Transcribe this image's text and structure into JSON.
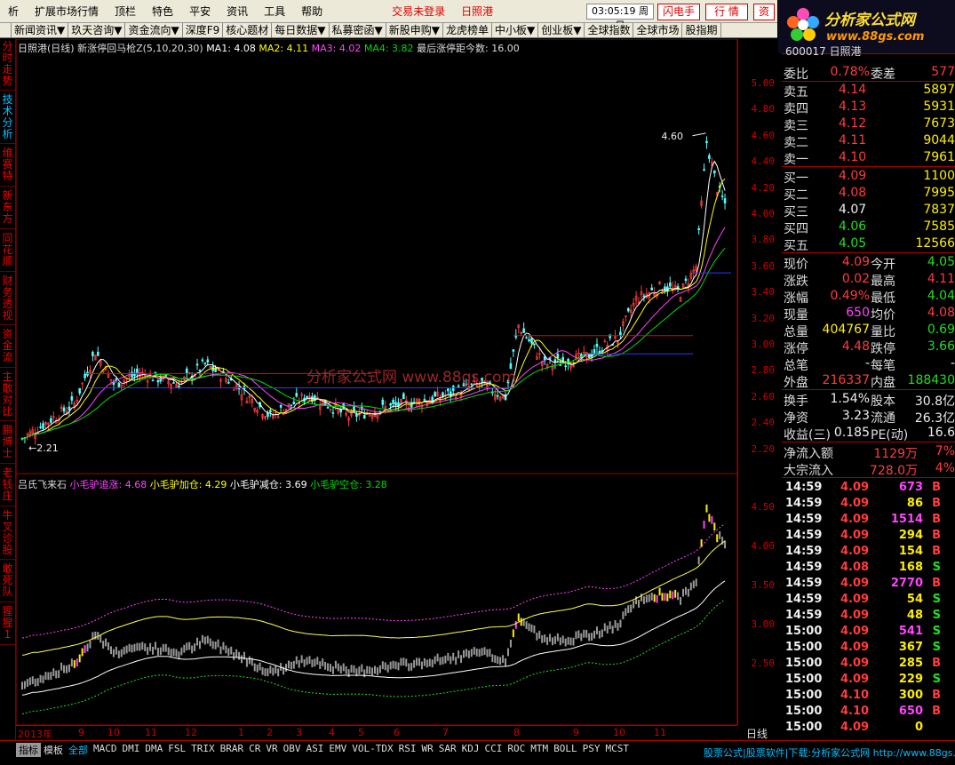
{
  "menu": {
    "items": [
      "析",
      "扩展市场行情",
      "顶栏",
      "特色",
      "平安",
      "资讯",
      "工具",
      "帮助"
    ],
    "trade_status": "交易未登录",
    "stock_name": "日照港",
    "clock": "03:05:19 周日",
    "btn_flash": "闪电手",
    "btn_quote": "行 情",
    "btn_info": "资"
  },
  "toolbar": [
    "新闻资讯▼",
    "玖天咨询▼",
    "资金流向▼",
    "深度F9",
    "核心题材",
    "每日数据▼",
    "私募密函▼",
    "新股申购▼",
    "龙虎榜单",
    "中小板▼",
    "创业板▼",
    "全球指数",
    "全球市场",
    "股指期"
  ],
  "logo": {
    "title": "分析家公式网",
    "url": "www.88gs.com"
  },
  "left_tabs": [
    "分时走势",
    "技术分析",
    "维赛特",
    "新东方",
    "同花顺",
    "财务透视",
    "资金流",
    "主散对比",
    "鹏博士",
    "老钱庄",
    "牛叉诊股",
    "敢死队",
    "猩猩1"
  ],
  "main_head": {
    "title": "日照港(日线) 新涨停回马枪Z(5,10,20,30)",
    "ma1": "MA1: 4.08",
    "ma2": "MA2: 4.11",
    "ma3": "MA3: 4.02",
    "ma4": "MA4: 3.82",
    "extra": "最后涨停距今数: 16.00"
  },
  "sub_head": {
    "name": "吕氏飞来石",
    "l1": "小毛驴追涨: 4.68",
    "l2": "小毛驴加仓: 4.29",
    "l3": "小毛驴减仓: 3.69",
    "l4": "小毛驴空仓: 3.28"
  },
  "watermark": "分析家公式网 www.88gs.com",
  "annotations": {
    "high": "4.60",
    "low": "2.21"
  },
  "price_axis": [
    "5.00",
    "4.80",
    "4.60",
    "4.40",
    "4.20",
    "4.00",
    "3.80",
    "3.60",
    "3.40",
    "3.20",
    "3.00",
    "2.80",
    "2.60",
    "2.40",
    "2.20"
  ],
  "sub_axis": [
    "4.50",
    "4.00",
    "3.50",
    "3.00",
    "2.50"
  ],
  "date_axis": [
    "2013年",
    "9",
    "10",
    "11",
    "12",
    "1",
    "2",
    "3",
    "4",
    "5",
    "6",
    "7",
    "8",
    "9",
    "10",
    "11"
  ],
  "period_label": "日线",
  "bottom_tabs": [
    "指标",
    "模板",
    "全部",
    "MACD",
    "DMI",
    "DMA",
    "FSL",
    "TRIX",
    "BRAR",
    "CR",
    "VR",
    "OBV",
    "ASI",
    "EMV",
    "VOL-TDX",
    "RSI",
    "WR",
    "SAR",
    "KDJ",
    "CCI",
    "ROC",
    "MTM",
    "BOLL",
    "PSY",
    "MCST"
  ],
  "footer": "股票公式|股票软件|下载:分析家公式网 http://www.88gs.com",
  "quote": {
    "code_line": "600017 日照港",
    "weibi": {
      "label": "委比",
      "value": "0.78%",
      "label2": "委差",
      "value2": "577"
    },
    "asks": [
      {
        "label": "卖五",
        "price": "4.14",
        "vol": "5897"
      },
      {
        "label": "卖四",
        "price": "4.13",
        "vol": "5931"
      },
      {
        "label": "卖三",
        "price": "4.12",
        "vol": "7673"
      },
      {
        "label": "卖二",
        "price": "4.11",
        "vol": "9044"
      },
      {
        "label": "卖一",
        "price": "4.10",
        "vol": "7961"
      }
    ],
    "bids": [
      {
        "label": "买一",
        "price": "4.09",
        "vol": "1100"
      },
      {
        "label": "买二",
        "price": "4.08",
        "vol": "7995"
      },
      {
        "label": "买三",
        "price": "4.07",
        "vol": "7837"
      },
      {
        "label": "买四",
        "price": "4.06",
        "vol": "7585"
      },
      {
        "label": "买五",
        "price": "4.05",
        "vol": "12566"
      }
    ],
    "stats": [
      {
        "l1": "现价",
        "v1": "4.09",
        "c1": "red",
        "l2": "今开",
        "v2": "4.05",
        "c2": "grn"
      },
      {
        "l1": "涨跌",
        "v1": "0.02",
        "c1": "red",
        "l2": "最高",
        "v2": "4.11",
        "c2": "red"
      },
      {
        "l1": "涨幅",
        "v1": "0.49%",
        "c1": "red",
        "l2": "最低",
        "v2": "4.04",
        "c2": "grn"
      },
      {
        "l1": "现量",
        "v1": "650",
        "c1": "mag",
        "l2": "均价",
        "v2": "4.08",
        "c2": "red"
      },
      {
        "l1": "总量",
        "v1": "404767",
        "c1": "yel",
        "l2": "量比",
        "v2": "0.69",
        "c2": "grn"
      },
      {
        "l1": "涨停",
        "v1": "4.48",
        "c1": "red",
        "l2": "跌停",
        "v2": "3.66",
        "c2": "grn"
      },
      {
        "l1": "总笔",
        "v1": "-",
        "c1": "wht",
        "l2": "每笔",
        "v2": "-",
        "c2": "wht"
      },
      {
        "l1": "外盘",
        "v1": "216337",
        "c1": "red",
        "l2": "内盘",
        "v2": "188430",
        "c2": "grn"
      }
    ],
    "fund": [
      {
        "l1": "换手",
        "v1": "1.54%",
        "c1": "wht",
        "l2": "股本",
        "v2": "30.8亿",
        "c2": "wht"
      },
      {
        "l1": "净资",
        "v1": "3.23",
        "c1": "wht",
        "l2": "流通",
        "v2": "26.3亿",
        "c2": "wht"
      },
      {
        "l1": "收益(三)",
        "v1": "0.185",
        "c1": "wht",
        "l2": "PE(动)",
        "v2": "16.6",
        "c2": "wht"
      }
    ],
    "flows": [
      {
        "label": "净流入额",
        "v1": "1129万",
        "v2": "7%"
      },
      {
        "label": "大宗流入",
        "v1": "728.0万",
        "v2": "4%"
      }
    ],
    "ticks": [
      {
        "t": "14:59",
        "p": "4.09",
        "v": "673",
        "s": "B"
      },
      {
        "t": "14:59",
        "p": "4.09",
        "v": "86",
        "s": "B"
      },
      {
        "t": "14:59",
        "p": "4.09",
        "v": "1514",
        "s": "B"
      },
      {
        "t": "14:59",
        "p": "4.09",
        "v": "294",
        "s": "B"
      },
      {
        "t": "14:59",
        "p": "4.09",
        "v": "154",
        "s": "B"
      },
      {
        "t": "14:59",
        "p": "4.08",
        "v": "168",
        "s": "S"
      },
      {
        "t": "14:59",
        "p": "4.09",
        "v": "2770",
        "s": "B"
      },
      {
        "t": "14:59",
        "p": "4.09",
        "v": "54",
        "s": "S"
      },
      {
        "t": "14:59",
        "p": "4.09",
        "v": "48",
        "s": "S"
      },
      {
        "t": "15:00",
        "p": "4.09",
        "v": "541",
        "s": "S"
      },
      {
        "t": "15:00",
        "p": "4.09",
        "v": "367",
        "s": "S"
      },
      {
        "t": "15:00",
        "p": "4.09",
        "v": "285",
        "s": "B"
      },
      {
        "t": "15:00",
        "p": "4.09",
        "v": "229",
        "s": "S"
      },
      {
        "t": "15:00",
        "p": "4.10",
        "v": "300",
        "s": "B"
      },
      {
        "t": "15:00",
        "p": "4.10",
        "v": "650",
        "s": "B"
      },
      {
        "t": "15:00",
        "p": "4.09",
        "v": "0",
        "s": ""
      }
    ]
  },
  "colors": {
    "up": "#ff3b3b",
    "down": "#22dd22",
    "ma1": "#ffffff",
    "ma2": "#ffff00",
    "ma3": "#ff44ff",
    "ma4": "#00dd00",
    "frame": "#aa0000"
  }
}
